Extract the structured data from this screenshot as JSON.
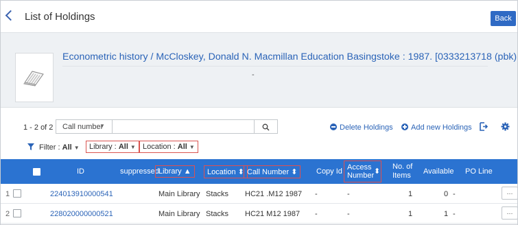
{
  "header": {
    "title": "List of Holdings",
    "back_label": "Back"
  },
  "record": {
    "title": "Econometric history / McCloskey, Donald N. Macmillan Education Basingstoke : 1987. [0333213718 (pbk) :]",
    "subtitle": "-"
  },
  "toolbar": {
    "count": "1 - 2 of 2",
    "search_field": "Call number",
    "search_value": "",
    "delete_label": "Delete Holdings",
    "add_label": "Add new Holdings"
  },
  "filters": {
    "filter_label": "Filter :",
    "filter_value": "All",
    "library_label": "Library :",
    "library_value": "All",
    "location_label": "Location :",
    "location_value": "All"
  },
  "table": {
    "headers": {
      "id": "ID",
      "suppressed": "suppressed",
      "library": "Library",
      "location": "Location",
      "call_number": "Call Number",
      "copy_id": "Copy Id",
      "access_number_1": "Access",
      "access_number_2": "Number",
      "items_1": "No. of",
      "items_2": "Items",
      "available": "Available",
      "po_line": "PO Line"
    },
    "rows": [
      {
        "num": "1",
        "id": "224013910000541",
        "library": "Main Library",
        "location": "Stacks",
        "call_number": "HC21 .M12 1987",
        "copy_id": "-",
        "access_number": "-",
        "items": "1",
        "available": "0",
        "po_line": "-",
        "more": "···"
      },
      {
        "num": "2",
        "id": "228020000000521",
        "library": "Main Library",
        "location": "Stacks",
        "call_number": "HC21 M12 1987",
        "copy_id": "-",
        "access_number": "-",
        "items": "1",
        "available": "1",
        "po_line": "-",
        "more": "···"
      }
    ]
  },
  "colors": {
    "accent": "#2f6ac4",
    "table_header": "#2b73d1",
    "link": "#2a63b7",
    "highlight_border": "#d9534f",
    "banner_bg": "#eef1f4"
  },
  "icons": [
    "chevron-left-icon",
    "book-icon",
    "search-icon",
    "filter-icon",
    "export-icon",
    "gear-icon",
    "sort-icon"
  ]
}
